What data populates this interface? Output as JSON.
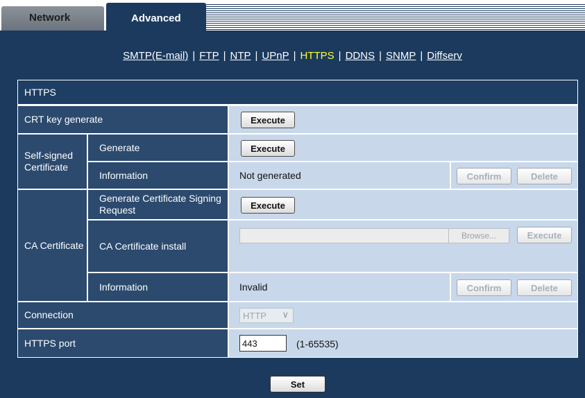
{
  "tabs": {
    "network": "Network",
    "advanced": "Advanced"
  },
  "subnav": {
    "items": [
      {
        "label": "SMTP(E-mail)",
        "current": false
      },
      {
        "label": "FTP",
        "current": false
      },
      {
        "label": "NTP",
        "current": false
      },
      {
        "label": "UPnP",
        "current": false
      },
      {
        "label": "HTTPS",
        "current": true
      },
      {
        "label": "DDNS",
        "current": false
      },
      {
        "label": "SNMP",
        "current": false
      },
      {
        "label": "Diffserv",
        "current": false
      }
    ],
    "separator": "|"
  },
  "section_title": "HTTPS",
  "crt": {
    "label": "CRT key generate",
    "button": "Execute"
  },
  "self_signed": {
    "label": "Self-signed Certificate",
    "generate_label": "Generate",
    "generate_button": "Execute",
    "info_label": "Information",
    "info_value": "Not generated",
    "confirm_button": "Confirm",
    "delete_button": "Delete"
  },
  "ca": {
    "label": "CA Certificate",
    "csr_label": "Generate Certificate Signing Request",
    "csr_button": "Execute",
    "install_label": "CA Certificate install",
    "browse_button": "Browse...",
    "install_button": "Execute",
    "info_label": "Information",
    "info_value": "Invalid",
    "confirm_button": "Confirm",
    "delete_button": "Delete"
  },
  "connection": {
    "label": "Connection",
    "value": "HTTP",
    "icon": "chevron-down-icon"
  },
  "https_port": {
    "label": "HTTPS port",
    "value": "443",
    "range": "(1-65535)"
  },
  "set_button": "Set",
  "colors": {
    "background": "#1b3a5e",
    "label_cell": "#2b4a6e",
    "value_cell": "#c8d8ea",
    "current_link": "#ffff33"
  }
}
